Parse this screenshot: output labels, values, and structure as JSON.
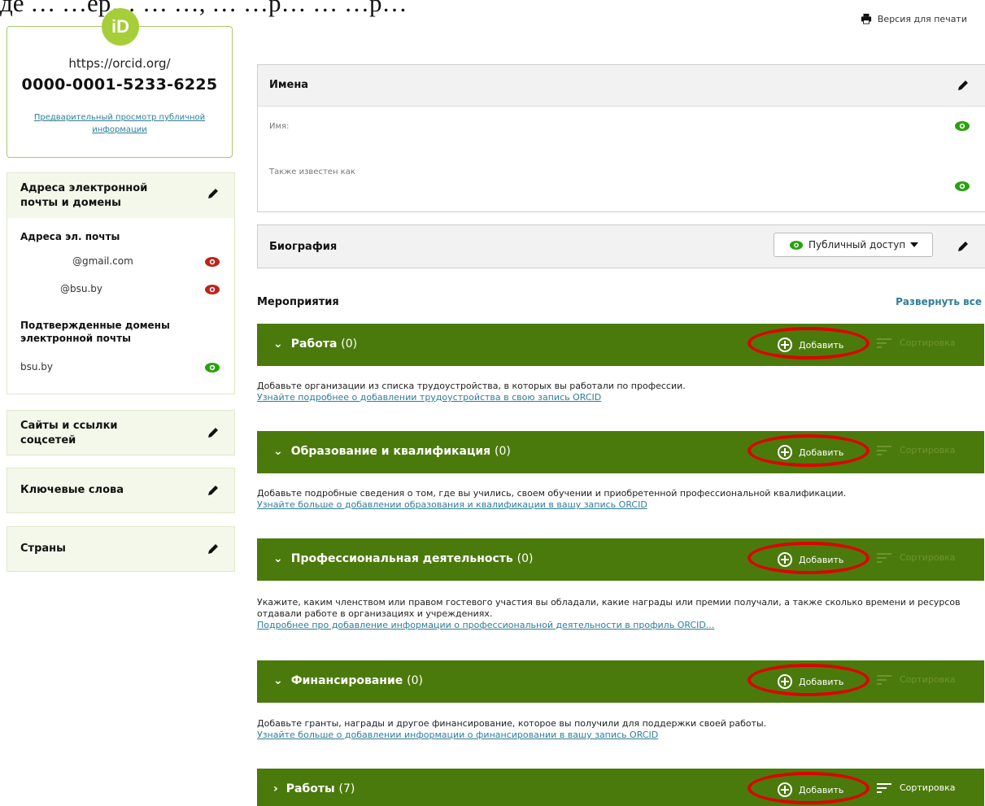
{
  "header": {
    "caption_fragment": "де … …ер… … …, … …р… … …р…",
    "print_label": "Версия для печати"
  },
  "id_card": {
    "logo_text": "iD",
    "url": "https://orcid.org/",
    "number": "0000-0001-5233-6225",
    "preview_link": "Предварительный просмотр публичной информации"
  },
  "sidebar": {
    "emails_section_title": "Адреса электронной почты и домены",
    "emails_label": "Адреса эл. почты",
    "emails": [
      {
        "value": "@gmail.com",
        "visibility": "private"
      },
      {
        "value": "@bsu.by",
        "visibility": "private"
      }
    ],
    "domains_label": "Подтвержденные домены электронной почты",
    "domains": [
      {
        "value": "bsu.by",
        "visibility": "public"
      }
    ],
    "websites_title": "Сайты и ссылки соцсетей",
    "keywords_title": "Ключевые слова",
    "countries_title": "Страны"
  },
  "names_panel": {
    "title": "Имена",
    "name_label": "Имя:",
    "also_known_label": "Также известен как"
  },
  "bio_panel": {
    "title": "Биография",
    "visibility_label": "Публичный доступ"
  },
  "activities": {
    "title": "Мероприятия",
    "expand_all": "Развернуть все",
    "add_label": "Добавить",
    "sort_label": "Сортировка",
    "sections": [
      {
        "title": "Работа",
        "count": "(0)",
        "desc": "Добавьте организации из списка трудоустройства, в которых вы работали по профессии.",
        "link": "Узнайте подробнее о добавлении трудоустройства в свою запись ORCID"
      },
      {
        "title": "Образование и квалификация",
        "count": "(0)",
        "desc": "Добавьте подробные сведения о том, где вы учились, своем обучении и приобретенной профессиональной квалификации.",
        "link": "Узнайте больше о добавлении образования и квалификации в вашу запись ORCID"
      },
      {
        "title": "Профессиональная деятельность",
        "count": "(0)",
        "desc": "Укажите, каким членством или правом гостевого участия вы обладали, какие награды или премии получали, а также сколько времени и ресурсов отдавали работе в организациях и учреждениях.",
        "link": "Подробнее про добавление информации о профессиональной деятельности в профиль ORCID..."
      },
      {
        "title": "Финансирование",
        "count": "(0)",
        "desc": "Добавьте гранты, награды и другое финансирование, которое вы получили для поддержки своей работы.",
        "link": "Узнайте больше о добавлении информации о финансировании в вашу запись ORCID"
      },
      {
        "title": "Работы",
        "count": "(7)"
      }
    ]
  },
  "colors": {
    "section_green": "#4b7a0c",
    "orcid_green": "#a6ce39",
    "private_red": "#c0221b",
    "public_green": "#2aa10f",
    "highlight_red": "#e00000"
  }
}
